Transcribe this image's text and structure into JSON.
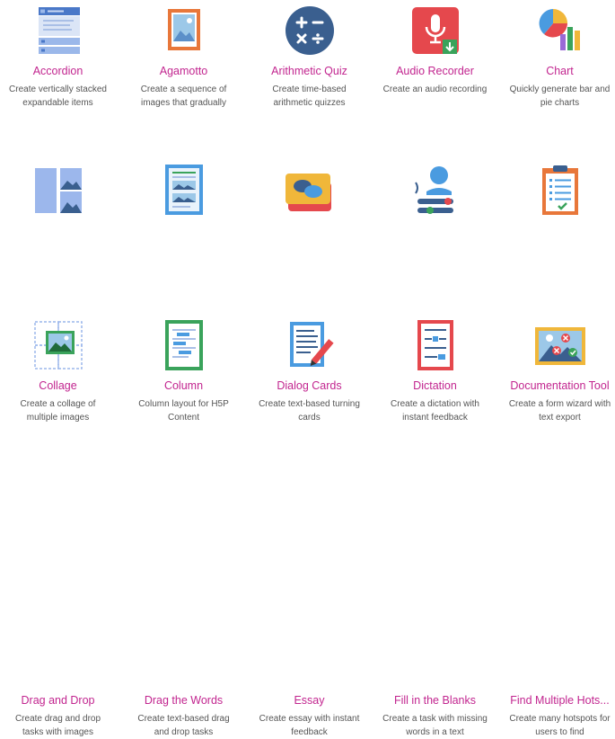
{
  "tiles": [
    {
      "title": "Accordion",
      "desc": "Create vertically stacked expandable items",
      "icon": "accordion-icon"
    },
    {
      "title": "Agamotto",
      "desc": "Create a sequence of images that gradually",
      "icon": "agamotto-icon"
    },
    {
      "title": "Arithmetic Quiz",
      "desc": "Create time-based arithmetic quizzes",
      "icon": "arithmetic-icon"
    },
    {
      "title": "Audio Recorder",
      "desc": "Create an audio recording",
      "icon": "microphone-icon"
    },
    {
      "title": "Chart",
      "desc": "Quickly generate bar and pie charts",
      "icon": "chart-icon"
    },
    {
      "title": "Collage",
      "desc": "Create a collage of multiple images",
      "icon": "collage-icon"
    },
    {
      "title": "Column",
      "desc": "Column layout for H5P Content",
      "icon": "column-icon"
    },
    {
      "title": "Dialog Cards",
      "desc": "Create text-based turning cards",
      "icon": "dialog-cards-icon"
    },
    {
      "title": "Dictation",
      "desc": "Create a dictation with instant feedback",
      "icon": "dictation-icon"
    },
    {
      "title": "Documentation Tool",
      "desc": "Create a form wizard with text export",
      "icon": "clipboard-icon"
    },
    {
      "title": "Drag and Drop",
      "desc": "Create drag and drop tasks with images",
      "icon": "drag-drop-icon"
    },
    {
      "title": "Drag the Words",
      "desc": "Create text-based drag and drop tasks",
      "icon": "drag-words-icon"
    },
    {
      "title": "Essay",
      "desc": "Create essay with instant feedback",
      "icon": "essay-icon"
    },
    {
      "title": "Fill in the Blanks",
      "desc": "Create a task with missing words in a text",
      "icon": "fill-blanks-icon"
    },
    {
      "title": "Find Multiple Hots...",
      "desc": "Create many hotspots for users to find",
      "icon": "hotspots-icon"
    }
  ],
  "colors": {
    "title": "#c2258f",
    "desc": "#555555"
  }
}
